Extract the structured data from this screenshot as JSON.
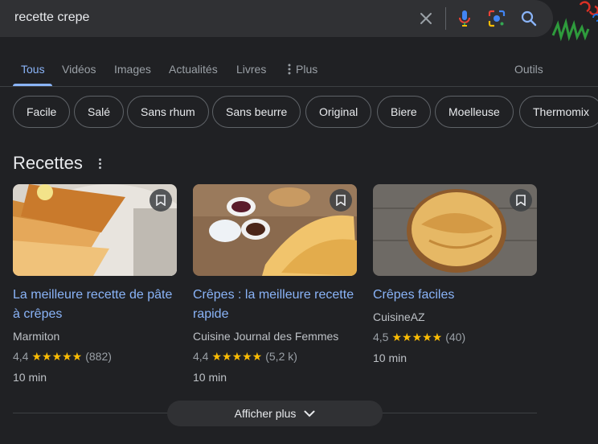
{
  "search": {
    "query": "recette crepe",
    "icons": [
      "close-icon",
      "mic-icon",
      "lens-icon",
      "search-icon"
    ]
  },
  "tabs": [
    {
      "label": "Tous",
      "active": true
    },
    {
      "label": "Vidéos"
    },
    {
      "label": "Images"
    },
    {
      "label": "Actualités"
    },
    {
      "label": "Livres"
    },
    {
      "label": "Plus"
    }
  ],
  "tools_label": "Outils",
  "chips": [
    "Facile",
    "Salé",
    "Sans rhum",
    "Sans beurre",
    "Original",
    "Biere",
    "Moelleuse",
    "Thermomix"
  ],
  "recipes_section": {
    "title": "Recettes",
    "items": [
      {
        "title": "La meilleure recette de pâte à crêpes",
        "source": "Marmiton",
        "rating": "4,4",
        "stars": 4.4,
        "stars_text": "★★★★★",
        "reviews": "(882)",
        "time": "10 min"
      },
      {
        "title": "Crêpes : la meilleure recette rapide",
        "source": "Cuisine Journal des Femmes",
        "rating": "4,4",
        "stars": 4.4,
        "stars_text": "★★★★★",
        "reviews": "(5,2 k)",
        "time": "10 min"
      },
      {
        "title": "Crêpes faciles",
        "source": "CuisineAZ",
        "rating": "4,5",
        "stars": 4.5,
        "stars_text": "★★★★★",
        "reviews": "(40)",
        "time": "10 min"
      }
    ]
  },
  "show_more_label": "Afficher plus",
  "colors": {
    "background": "#202124",
    "link": "#8ab4f8",
    "star": "#fbbc04",
    "surface": "#303134"
  }
}
